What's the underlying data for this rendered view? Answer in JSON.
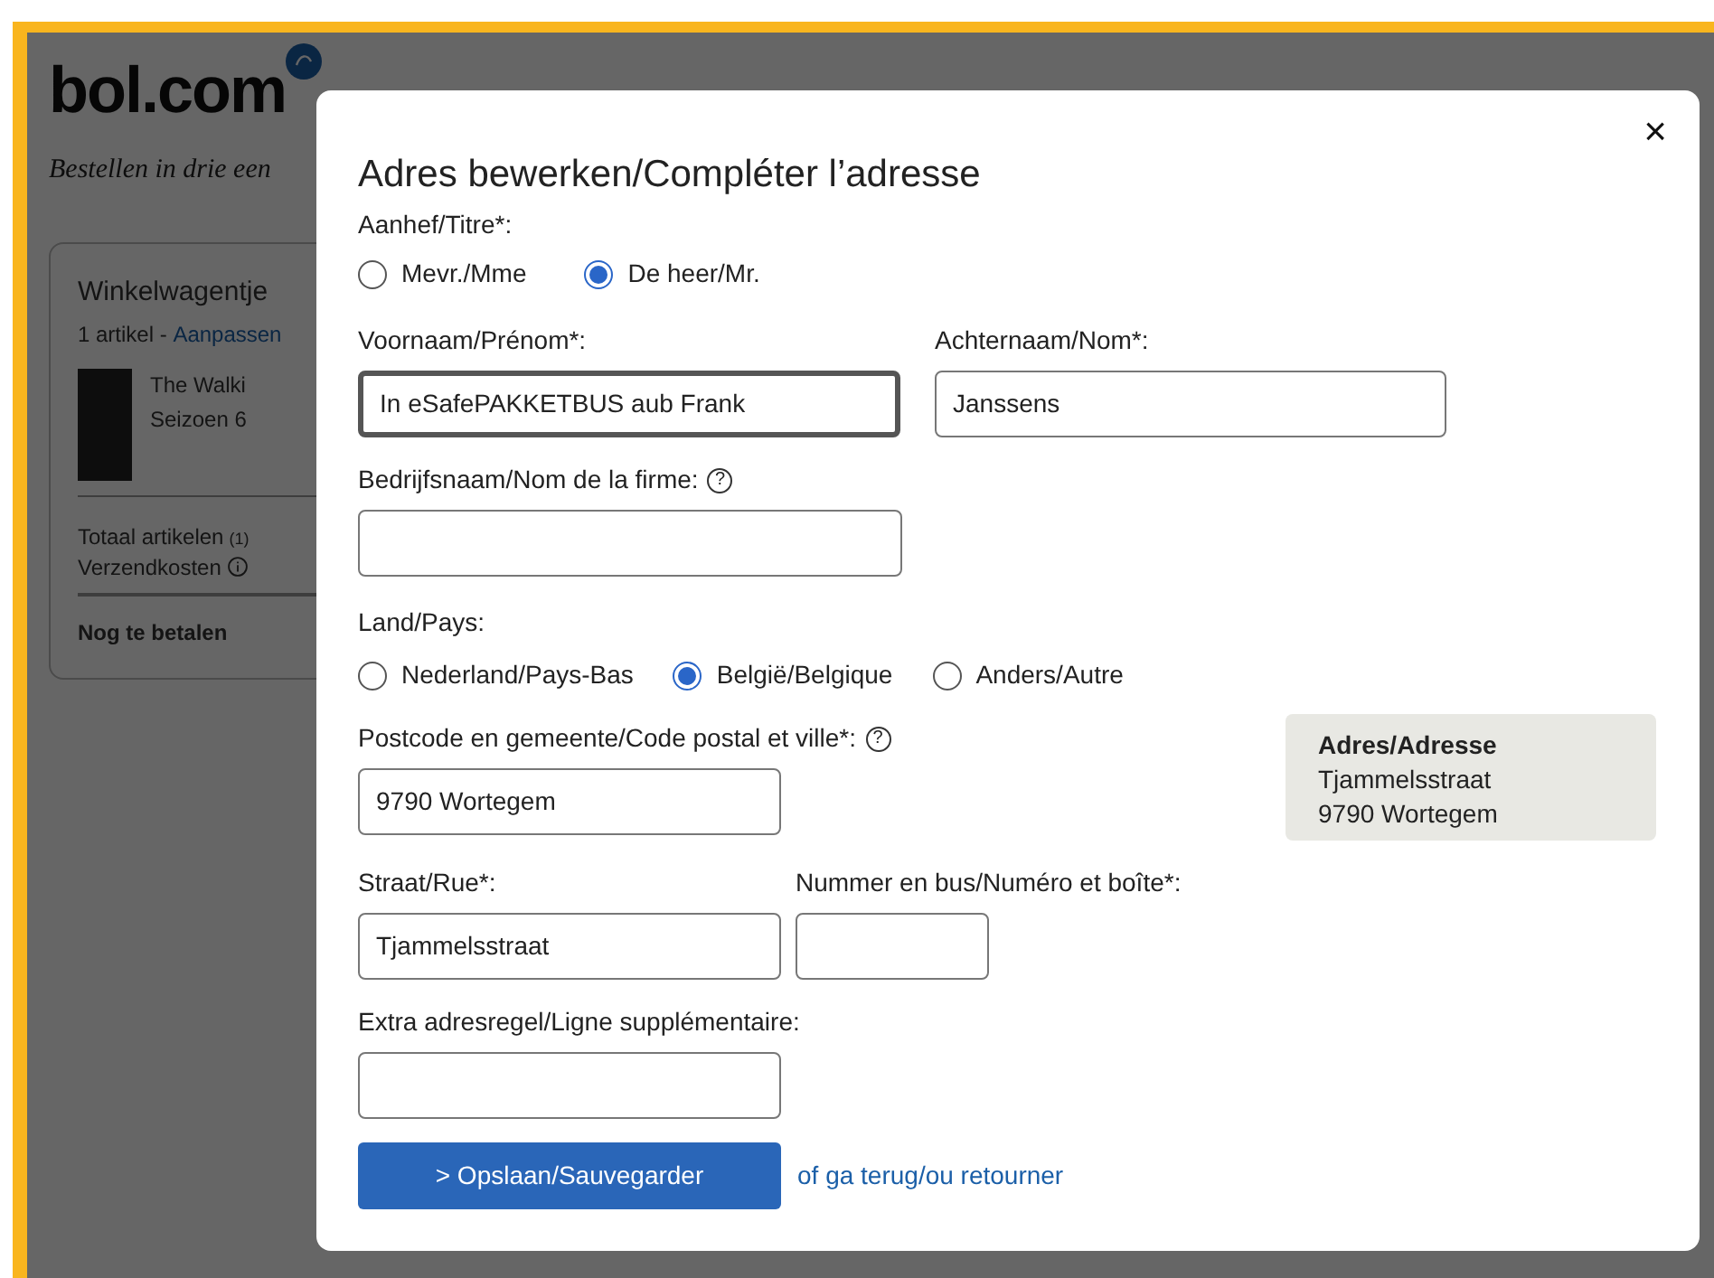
{
  "page": {
    "logo": "bol.com",
    "tagline": "Bestellen in drie een",
    "cart": {
      "title": "Winkelwagentje",
      "count": "1 artikel - ",
      "edit_link": "Aanpassen",
      "product_title": "The Walki",
      "product_subtitle": "Seizoen 6",
      "total_label": "Totaal artikelen",
      "total_count": "(1)",
      "shipping_label": "Verzendkosten",
      "to_pay_label": "Nog te betalen"
    }
  },
  "dialog": {
    "close": "×",
    "title": "Adres bewerken/Compléter l’adresse",
    "salutation": {
      "label": "Aanhef/Titre*:",
      "options": [
        {
          "label": "Mevr./Mme",
          "selected": false
        },
        {
          "label": "De heer/Mr.",
          "selected": true
        }
      ]
    },
    "first_name": {
      "label": "Voornaam/Prénom*:",
      "value": "In eSafePAKKETBUS aub Frank",
      "focused": true
    },
    "last_name": {
      "label": "Achternaam/Nom*:",
      "value": "Janssens",
      "focused": false
    },
    "company": {
      "label": "Bedrijfsnaam/Nom de la firme:",
      "help": "?"
    },
    "country": {
      "label": "Land/Pays:",
      "options": [
        {
          "label": "Nederland/Pays-Bas",
          "selected": false
        },
        {
          "label": "België/Belgique",
          "selected": true
        },
        {
          "label": "Anders/Autre",
          "selected": false
        }
      ]
    },
    "postal": {
      "label": "Postcode en gemeente/Code postal et ville*:",
      "value": "9790 Wortegem",
      "help": "?"
    },
    "address_preview": {
      "title": "Adres/Adresse",
      "lines": [
        "Tjammelsstraat",
        "9790 Wortegem"
      ]
    },
    "street": {
      "label": "Straat/Rue*:",
      "value": "Tjammelsstraat"
    },
    "number": {
      "label": "Nummer en bus/Numéro et boîte*:"
    },
    "extra": {
      "label": "Extra adresregel/Ligne supplémentaire:"
    },
    "save_button": "> Opslaan/Sauvegarder",
    "back_link": "of ga terug/ou retourner"
  }
}
